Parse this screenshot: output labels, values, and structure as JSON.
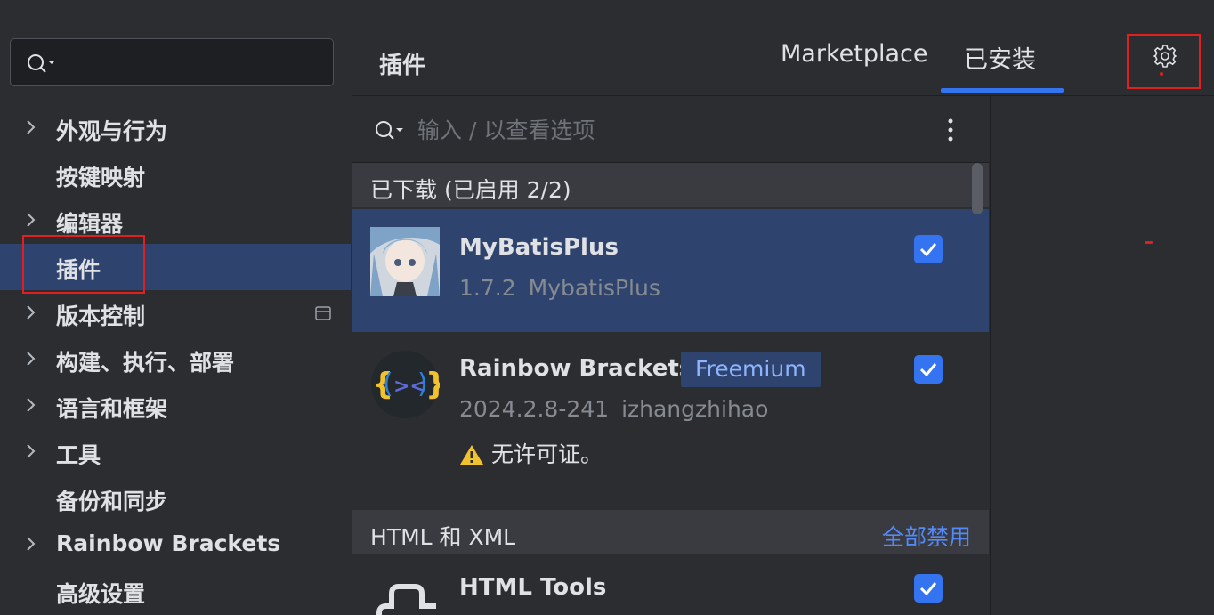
{
  "sidebar": {
    "search_placeholder": "",
    "items": [
      {
        "label": "外观与行为",
        "chevron": true
      },
      {
        "label": "按键映射",
        "chevron": false
      },
      {
        "label": "编辑器",
        "chevron": true
      },
      {
        "label": "插件",
        "chevron": false,
        "selected": true
      },
      {
        "label": "版本控制",
        "chevron": true
      },
      {
        "label": "构建、执行、部署",
        "chevron": true
      },
      {
        "label": "语言和框架",
        "chevron": true
      },
      {
        "label": "工具",
        "chevron": true
      },
      {
        "label": "备份和同步",
        "chevron": false
      },
      {
        "label": "Rainbow Brackets",
        "chevron": true
      },
      {
        "label": "高级设置",
        "chevron": false
      }
    ]
  },
  "header": {
    "title": "插件",
    "tabs": [
      {
        "label": "Marketplace",
        "active": false
      },
      {
        "label": "已安装",
        "active": true
      }
    ]
  },
  "filter": {
    "placeholder": "输入 / 以查看选项"
  },
  "groups": [
    {
      "label": "已下载 (已启用 2/2)",
      "action": "",
      "plugins": [
        {
          "name": "MyBatisPlus",
          "version": "1.7.2",
          "vendor": "MybatisPlus",
          "enabled": true,
          "selected": true
        },
        {
          "name": "Rainbow Brackets",
          "badge": "Freemium",
          "version": "2024.2.8-241",
          "vendor": "izhangzhihao",
          "warning": "无许可证。",
          "enabled": true
        }
      ]
    },
    {
      "label": "HTML 和 XML",
      "action": "全部禁用",
      "plugins": [
        {
          "name": "HTML Tools",
          "enabled": true
        }
      ]
    }
  ],
  "colors": {
    "accent": "#3574f0",
    "selection": "#2e436e",
    "highlight_box": "#e02020",
    "link": "#548af7"
  }
}
